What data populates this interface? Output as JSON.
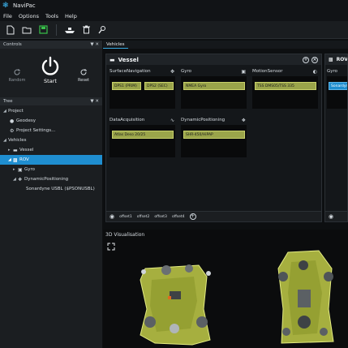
{
  "app": {
    "title": "NaviPac"
  },
  "menu": [
    "File",
    "Options",
    "Tools",
    "Help"
  ],
  "toolbar": {
    "icons": [
      "new-file-icon",
      "open-folder-icon",
      "save-icon",
      "boat-icon",
      "trash-icon",
      "tools-icon"
    ]
  },
  "controls": {
    "title": "Controls",
    "pin": "▼ ✕",
    "random_label": "Random",
    "start_label": "Start",
    "reset_label": "Reset"
  },
  "tree": {
    "title": "Tree",
    "project_label": "Project",
    "geodesy_label": "Geodesy",
    "project_settings_label": "Project Settings...",
    "vehicles_label": "Vehicles",
    "vessel_label": "Vessel",
    "rov_label": "ROV",
    "gyro_label": "Gyro",
    "dynpos_label": "DynamicPositioning",
    "sonardyne_label": "Sonardyne USBL ($PSONUSBL)"
  },
  "vehicles_tab": {
    "label": "Vehicles"
  },
  "vessel_panel": {
    "title": "Vessel",
    "cards": {
      "surface_nav": {
        "label": "SurfaceNavigation",
        "items": [
          "DPS1 (PRIM)",
          "DPS2 (SEC)"
        ]
      },
      "gyro": {
        "label": "Gyro",
        "items": [
          "NMEA Gyro"
        ]
      },
      "motion": {
        "label": "MotionSensor",
        "items": [
          "TSS DMS05/TSS 335"
        ]
      },
      "data_acq": {
        "label": "DataAcquisition",
        "items": [
          "Atlas Deso 20/25"
        ]
      },
      "dynpos": {
        "label": "DynamicPositioning",
        "items": [
          "SHR-450/HiPAP"
        ]
      }
    },
    "offsets": [
      "offset1",
      "offset2",
      "offset3",
      "offset4"
    ]
  },
  "rov_panel": {
    "title": "ROV",
    "gyro_label": "Gyro",
    "item": "Sonardyne"
  },
  "visualisation": {
    "title": "3D Visualisation"
  },
  "colors": {
    "accent": "#1f8ed0",
    "pill": "#9aa44a",
    "rov_body": "#c8d34a"
  }
}
